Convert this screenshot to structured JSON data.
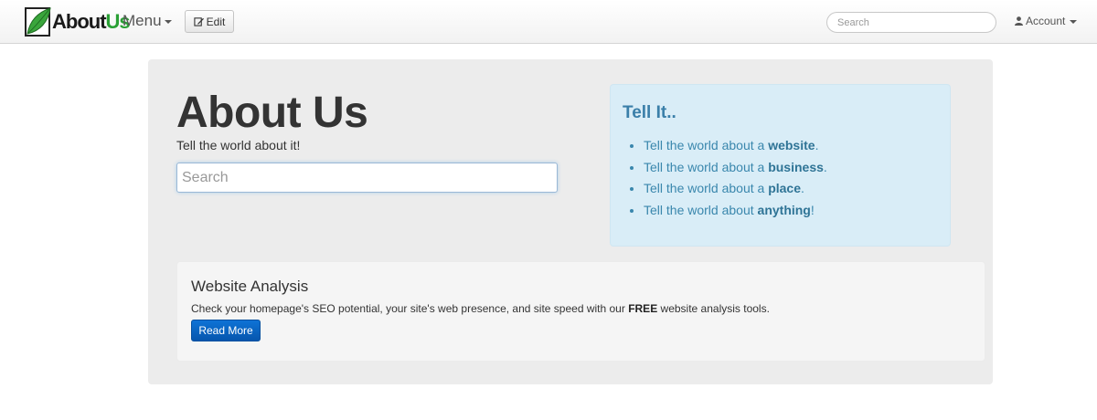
{
  "navbar": {
    "logo_text_about": "About",
    "logo_text_us": "Us",
    "menu_label": "Menu",
    "edit_label": "Edit",
    "search_placeholder": "Search",
    "account_label": "Account"
  },
  "hero": {
    "title": "About Us",
    "subtitle": "Tell the world about it!",
    "search_placeholder": "Search"
  },
  "tell_it": {
    "title": "Tell It..",
    "items": [
      {
        "prefix": "Tell the world about a ",
        "bold": "website",
        "suffix": "."
      },
      {
        "prefix": "Tell the world about a ",
        "bold": "business",
        "suffix": "."
      },
      {
        "prefix": "Tell the world about a ",
        "bold": "place",
        "suffix": "."
      },
      {
        "prefix": "Tell the world about ",
        "bold": "anything",
        "suffix": "!"
      }
    ]
  },
  "analysis": {
    "title": "Website Analysis",
    "text_before": "Check your homepage's SEO potential, your site's web presence, and site speed with our ",
    "text_bold": "FREE",
    "text_after": " website analysis tools.",
    "button_label": "Read More"
  },
  "colors": {
    "accent_green": "#2aa035",
    "info_blue": "#3a87ad",
    "button_blue": "#0656ad"
  }
}
